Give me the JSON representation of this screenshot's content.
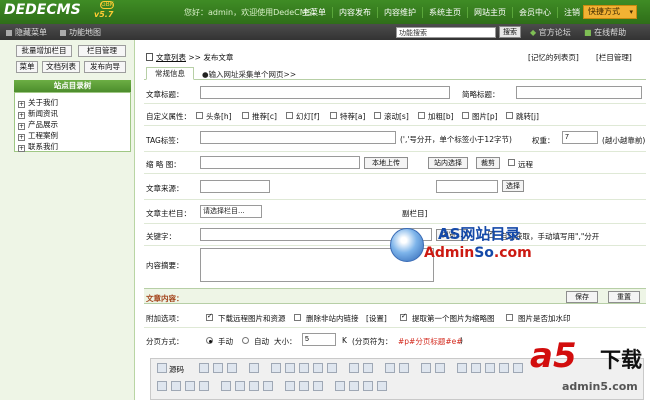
{
  "header": {
    "logo": "DEDECMS",
    "version": "v5.7",
    "badge": "GBK",
    "welcome": "您好：admin，欢迎使用DedeCMS！",
    "nav": [
      "主菜单",
      "内容发布",
      "内容维护",
      "系统主页",
      "网站主页",
      "会员中心",
      "注销"
    ],
    "quick": "快捷方式"
  },
  "subbar": {
    "hide_menu": "隐藏菜单",
    "feature_map": "功能地图",
    "search_placeholder": "功能搜索",
    "search_button": "搜索",
    "forum": "官方论坛",
    "help": "在线帮助"
  },
  "sidebar": {
    "buttons": [
      "批量增加栏目",
      "栏目管理",
      "菜单",
      "文档列表",
      "发布向导"
    ],
    "tree_title": "站点目录树",
    "tree_items": [
      "关于我们",
      "新闻资讯",
      "产品展示",
      "工程案例",
      "联系我们"
    ]
  },
  "main": {
    "crumb_link": "文章列表",
    "crumb_sep": ">>",
    "crumb_current": "发布文章",
    "remember_link": "[记忆的列表页]",
    "column_manage": "[栏目管理]",
    "tab_basic": "常规信息",
    "tab_import": "●输入网址采集单个网页>>",
    "title_label": "文章标题：",
    "short_title_label": "简略标题：",
    "custom_attr_label": "自定义属性：",
    "attrs": [
      "头条[h]",
      "推荐[c]",
      "幻灯[f]",
      "特荐[a]",
      "滚动[s]",
      "加粗[b]",
      "图片[p]",
      "跳转[j]"
    ],
    "tag_label": "TAG标签：",
    "tag_hint": "(','号分开，单个标签小于12字节)",
    "weight_label": "权重：",
    "weight_value": "7",
    "weight_hint": "(越小越靠前)",
    "thumb_label": "缩 略 图：",
    "upload_local": "本地上传",
    "choose_site": "站内选择",
    "crop": "裁剪",
    "remote": "远程",
    "source_label": "文章来源：",
    "choose": "选择",
    "column_label": "文章主栏目：",
    "column_select": "请选择栏目...",
    "column_extra": "副栏目",
    "keywords_label": "关键字：",
    "browse": "浏览...",
    "auto_get": "自动获取，手动填写用\",\"分开",
    "summary_label": "内容摘要：",
    "content_title": "文章内容：",
    "save": "保存",
    "reset": "重置",
    "options_label": "附加选项：",
    "opt_download": "下载远程图片和资源",
    "opt_remove_links": "删除非站内链接",
    "opt_settings": "[设置]",
    "opt_first_img": "提取第一个图片为缩略图",
    "opt_watermark": "图片是否加水印",
    "paging_label": "分页方式：",
    "paging_manual": "手动",
    "paging_auto": "自动",
    "paging_size_label": "大小：",
    "paging_size": "5",
    "paging_unit": "K",
    "paging_note": "(分页符为：",
    "paging_marker": "#p#分页标题#e#",
    "paging_note_end": ")",
    "source_btn": "源码"
  },
  "watermarks": {
    "as_title": "AS网站目录",
    "as_url_red": "Admin",
    "as_url_blue": "So",
    "as_url_tail": ".com",
    "a5": "a5",
    "a5_text": "下载",
    "a5_url": "admin5.com"
  },
  "colors": {
    "header_green": "#3f8c25",
    "sidebar_bg": "#eef5e6",
    "quick_orange": "#f2b233",
    "accent_red": "#a3431a"
  }
}
